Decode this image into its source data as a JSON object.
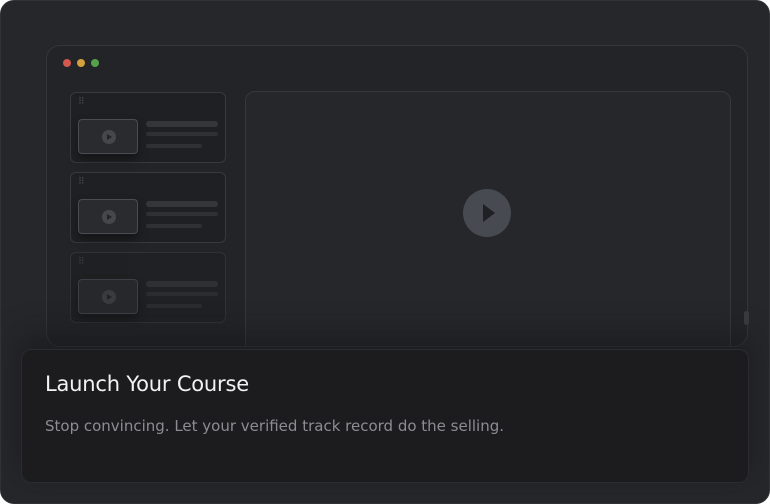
{
  "window": {
    "controls": [
      "close-dot",
      "minimize-dot",
      "maximize-dot"
    ],
    "colors": {
      "close": "#d1584c",
      "minimize": "#d3a13b",
      "maximize": "#55a24a"
    }
  },
  "lessons": [
    {
      "icon": "drag-handle-icon",
      "thumb_icon": "play-icon"
    },
    {
      "icon": "drag-handle-icon",
      "thumb_icon": "play-icon"
    },
    {
      "icon": "drag-handle-icon",
      "thumb_icon": "play-icon"
    }
  ],
  "player": {
    "icon": "play-icon"
  },
  "caption": {
    "title": "Launch Your Course",
    "subtitle": "Stop convincing. Let your verified track record do the selling."
  }
}
